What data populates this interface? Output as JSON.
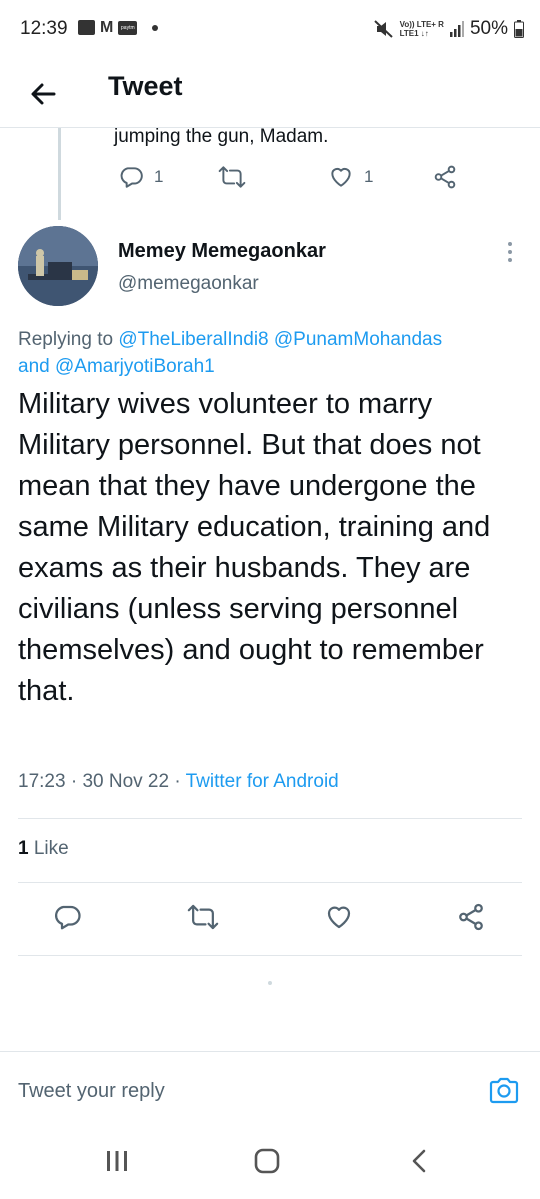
{
  "status_bar": {
    "time": "12:39",
    "network_line1": "Vo)) LTE+ R",
    "network_line2": "LTE1 ↓↑",
    "battery": "50%"
  },
  "header": {
    "title": "Tweet"
  },
  "previous_tweet": {
    "text": "jumping the gun, Madam.",
    "reply_count": "1",
    "like_count": "1"
  },
  "tweet": {
    "author_name": "Memey Memegaonkar",
    "author_handle": "@memegaonkar",
    "replying_prefix": "Replying to",
    "mention_1": "@TheLiberalIndi8",
    "mention_2": "@PunamMohandas",
    "mention_join": "and",
    "mention_3": "@AmarjyotiBorah1",
    "body": "Military wives volunteer to marry Military personnel. But that does not mean that they have undergone the same Military education, training and exams as their husbands. They are civilians (unless serving personnel themselves) and ought to remember that.",
    "time": "17:23",
    "separator": " · ",
    "date": "30 Nov 22",
    "source": "Twitter for Android",
    "like_count": "1",
    "like_label": "Like"
  },
  "reply_bar": {
    "placeholder": "Tweet your reply"
  },
  "colors": {
    "accent": "#1d9bf0",
    "text_primary": "#0f1419",
    "text_secondary": "#536471",
    "divider": "#e1e6ea"
  },
  "icons": [
    "back-arrow-icon",
    "reply-icon",
    "retweet-icon",
    "like-icon",
    "share-icon",
    "more-icon",
    "camera-icon",
    "recents-icon",
    "home-icon",
    "nav-back-icon"
  ]
}
